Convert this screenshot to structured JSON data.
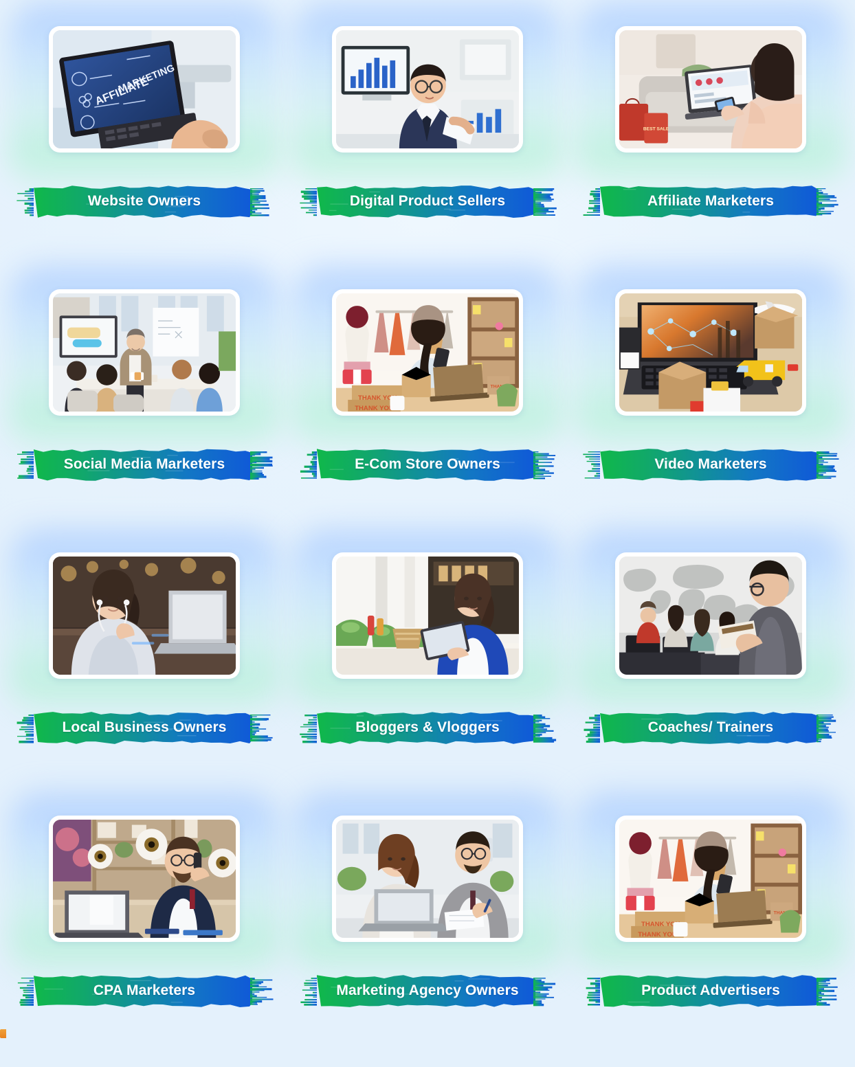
{
  "page": {
    "background_color": "#e9f4fd",
    "columns": 3,
    "rows": 4
  },
  "theme": {
    "brush_gradient_start": "#10b84a",
    "brush_gradient_mid": "#11899b",
    "brush_gradient_end": "#1059d8",
    "label_color": "#ffffff",
    "card_frame_color": "#ffffff",
    "glow_top_color": "#a0c4ff",
    "glow_bottom_color": "#a8f0cd",
    "corner_fleck_color": "#e8821f"
  },
  "cards": [
    {
      "label": "Website Owners",
      "image_name": "affiliate-marketing-laptop-photo",
      "image_alt": "Hands typing on a laptop displaying an AFFILIATE MARKETING infographic on a blue screen"
    },
    {
      "label": "Digital Product Sellers",
      "image_name": "businessman-with-charts-photo",
      "image_alt": "Smiling businessman in a suit holding documents in front of monitors showing bar charts"
    },
    {
      "label": "Affiliate Marketers",
      "image_name": "online-shopper-sofa-photo",
      "image_alt": "Woman on a sofa shopping online with a laptop and phone beside red sale shopping bags"
    },
    {
      "label": "Social Media Marketers",
      "image_name": "office-workshop-meeting-photo",
      "image_alt": "Presenter leading a marketing workshop for a seated team in a bright meeting room"
    },
    {
      "label": "E-Com Store Owners",
      "image_name": "ecommerce-packing-thank-you-photo",
      "image_alt": "Woman packing orders with THANK YOU boxes, clothing rack and laptop in a small shop"
    },
    {
      "label": "Video Marketers",
      "image_name": "logistics-laptop-toy-truck-photo",
      "image_alt": "Laptop showing a glowing logistics network beside cardboard boxes, a toy delivery van and a model plane"
    },
    {
      "label": "Local Business Owners",
      "image_name": "woman-earphones-laptop-photo",
      "image_alt": "Woman wearing earphones working on a laptop in a warmly lit cafe at night"
    },
    {
      "label": "Bloggers & Vloggers",
      "image_name": "woman-tablet-cafe-photo",
      "image_alt": "Woman in a blue blazer using a tablet at a bright cafe counter with plants"
    },
    {
      "label": "Coaches/ Trainers",
      "image_name": "trainer-world-map-classroom-photo",
      "image_alt": "Trainer with a clipboard addressing four seated students in a computer classroom with a world map wall"
    },
    {
      "label": "CPA Marketers",
      "image_name": "man-phone-call-eyeballs-photo",
      "image_alt": "Bearded man in a suit on a phone call at his laptop with large floating eyeball graphics"
    },
    {
      "label": "Marketing Agency Owners",
      "image_name": "two-colleagues-laptop-office-photo",
      "image_alt": "Two colleagues reviewing paperwork together at a laptop in a modern open-plan office"
    },
    {
      "label": "Product Advertisers",
      "image_name": "ecommerce-packing-thank-you-photo-2",
      "image_alt": "Woman packing orders with THANK YOU boxes, clothing rack and laptop in a small shop"
    }
  ]
}
